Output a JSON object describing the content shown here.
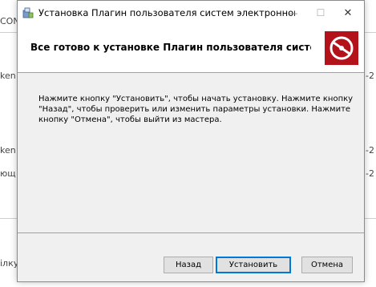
{
  "window": {
    "title": "Установка Плагин пользователя систем электронного пр...",
    "minimize_glyph": "—",
    "maximize_glyph": "☐",
    "close_glyph": "✕"
  },
  "header": {
    "title": "Все готово к установке Плагин пользователя систем электр..."
  },
  "body": {
    "text": "Нажмите кнопку \"Установить\", чтобы начать установку. Нажмите кнопку \"Назад\", чтобы проверить или изменить параметры установки. Нажмите кнопку \"Отмена\", чтобы выйти из мастера."
  },
  "buttons": {
    "back": "Назад",
    "install": "Установить",
    "cancel": "Отмена"
  },
  "background": {
    "frag_1": "CON",
    "frag_2": "ken",
    "frag_3": "ken",
    "frag_4": "ющ",
    "frag_5": "ілку",
    "frag_6": "-2",
    "frag_7": "-2",
    "frag_8": "-2"
  },
  "colors": {
    "accent": "#0078d7",
    "logo_bg": "#b3121b",
    "dialog_bg": "#f0f0f0"
  },
  "icons": {
    "app": "installer-package-icon",
    "logo": "crossed-disc-logo-icon"
  }
}
